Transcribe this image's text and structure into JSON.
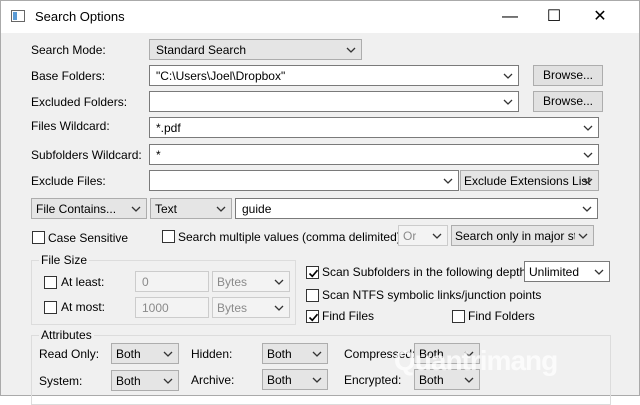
{
  "window": {
    "title": "Search Options",
    "minimize_glyph": "—",
    "maximize_glyph": "☐",
    "close_glyph": "✕"
  },
  "rows": {
    "search_mode": {
      "label": "Search Mode:",
      "value": "Standard Search"
    },
    "base_folders": {
      "label": "Base Folders:",
      "value": "\"C:\\Users\\Joel\\Dropbox\"",
      "button": "Browse..."
    },
    "excluded_folders": {
      "label": "Excluded Folders:",
      "value": "",
      "button": "Browse..."
    },
    "files_wildcard": {
      "label": "Files Wildcard:",
      "value": "*.pdf"
    },
    "subfolders_wildcard": {
      "label": "Subfolders Wildcard:",
      "value": "*"
    },
    "exclude_files": {
      "label": "Exclude Files:",
      "value": "",
      "mode": "Exclude Extensions List"
    }
  },
  "contains": {
    "type": "File Contains...",
    "format": "Text",
    "text": "guide"
  },
  "options": {
    "case_sensitive": {
      "label": "Case Sensitive",
      "checked": false
    },
    "multiple_values": {
      "label": "Search multiple values (comma delimited)",
      "checked": false
    },
    "operator": "Or",
    "search_scope": "Search only in major stre"
  },
  "file_size": {
    "title": "File Size",
    "at_least": {
      "label": "At least:",
      "value": "0",
      "unit": "Bytes",
      "checked": false
    },
    "at_most": {
      "label": "At most:",
      "value": "1000",
      "unit": "Bytes",
      "checked": false
    }
  },
  "scan": {
    "subfolders": {
      "label": "Scan Subfolders in the following depth:",
      "checked": true,
      "depth": "Unlimited"
    },
    "ntfs": {
      "label": "Scan NTFS symbolic links/junction points",
      "checked": false
    },
    "find_files": {
      "label": "Find Files",
      "checked": true
    },
    "find_folders": {
      "label": "Find Folders",
      "checked": false
    }
  },
  "attributes": {
    "title": "Attributes",
    "read_only": {
      "label": "Read Only:",
      "value": "Both"
    },
    "hidden": {
      "label": "Hidden:",
      "value": "Both"
    },
    "compressed": {
      "label": "Compressed:",
      "value": "Both"
    },
    "system": {
      "label": "System:",
      "value": "Both"
    },
    "archive": {
      "label": "Archive:",
      "value": "Both"
    },
    "encrypted": {
      "label": "Encrypted:",
      "value": "Both"
    }
  },
  "watermark": "Quantrimang"
}
